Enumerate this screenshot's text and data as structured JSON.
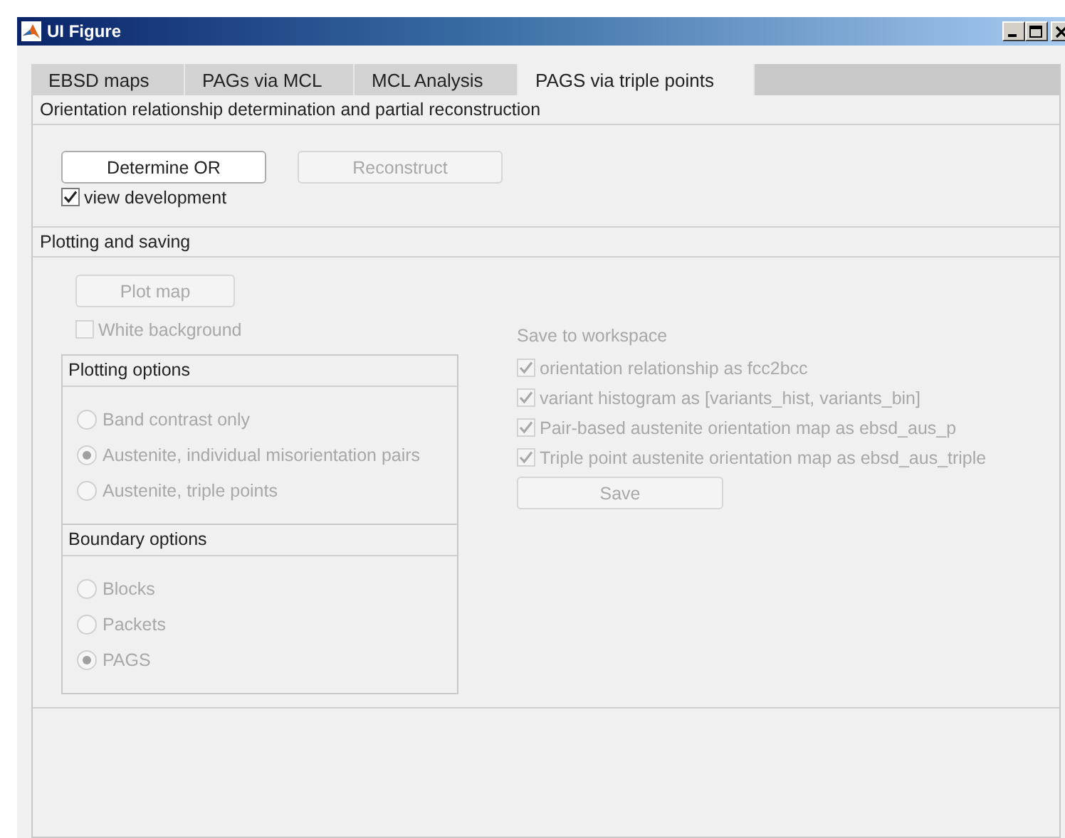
{
  "window": {
    "title": "UI Figure"
  },
  "tabs": [
    {
      "label": "EBSD maps",
      "selected": false
    },
    {
      "label": "PAGs via MCL",
      "selected": false
    },
    {
      "label": "MCL Analysis",
      "selected": false
    },
    {
      "label": "PAGS via triple points",
      "selected": true
    }
  ],
  "orientation_section": {
    "header": "Orientation relationship determination and partial reconstruction",
    "buttons": [
      {
        "label": "Determine OR",
        "disabled": false
      },
      {
        "label": "Reconstruct",
        "disabled": true
      }
    ],
    "checkbox": {
      "label": "view development",
      "checked": true,
      "disabled": false
    }
  },
  "plotting_section": {
    "header": "Plotting and saving",
    "plot_button": {
      "label": "Plot map",
      "disabled": true
    },
    "white_background": {
      "label": "White background",
      "checked": false,
      "disabled": true
    },
    "groups": [
      {
        "title": "Plotting options",
        "radios": [
          {
            "label": "Band contrast only",
            "selected": false,
            "disabled": true
          },
          {
            "label": "Austenite, individual misorientation pairs",
            "selected": true,
            "disabled": true
          },
          {
            "label": "Austenite, triple points",
            "selected": false,
            "disabled": true
          }
        ]
      },
      {
        "title": "Boundary options",
        "radios": [
          {
            "label": "Blocks",
            "selected": false,
            "disabled": true
          },
          {
            "label": "Packets",
            "selected": false,
            "disabled": true
          },
          {
            "label": "PAGS",
            "selected": true,
            "disabled": true
          }
        ]
      }
    ],
    "save": {
      "title": "Save to workspace",
      "checkboxes": [
        {
          "label": "orientation relationship as fcc2bcc",
          "checked": true,
          "disabled": true
        },
        {
          "label": "variant histogram as [variants_hist, variants_bin]",
          "checked": true,
          "disabled": true
        },
        {
          "label": "Pair-based austenite orientation map as ebsd_aus_p",
          "checked": true,
          "disabled": true
        },
        {
          "label": "Triple point austenite orientation map as ebsd_aus_triple",
          "checked": true,
          "disabled": true
        }
      ],
      "button": {
        "label": "Save",
        "disabled": true
      }
    }
  }
}
